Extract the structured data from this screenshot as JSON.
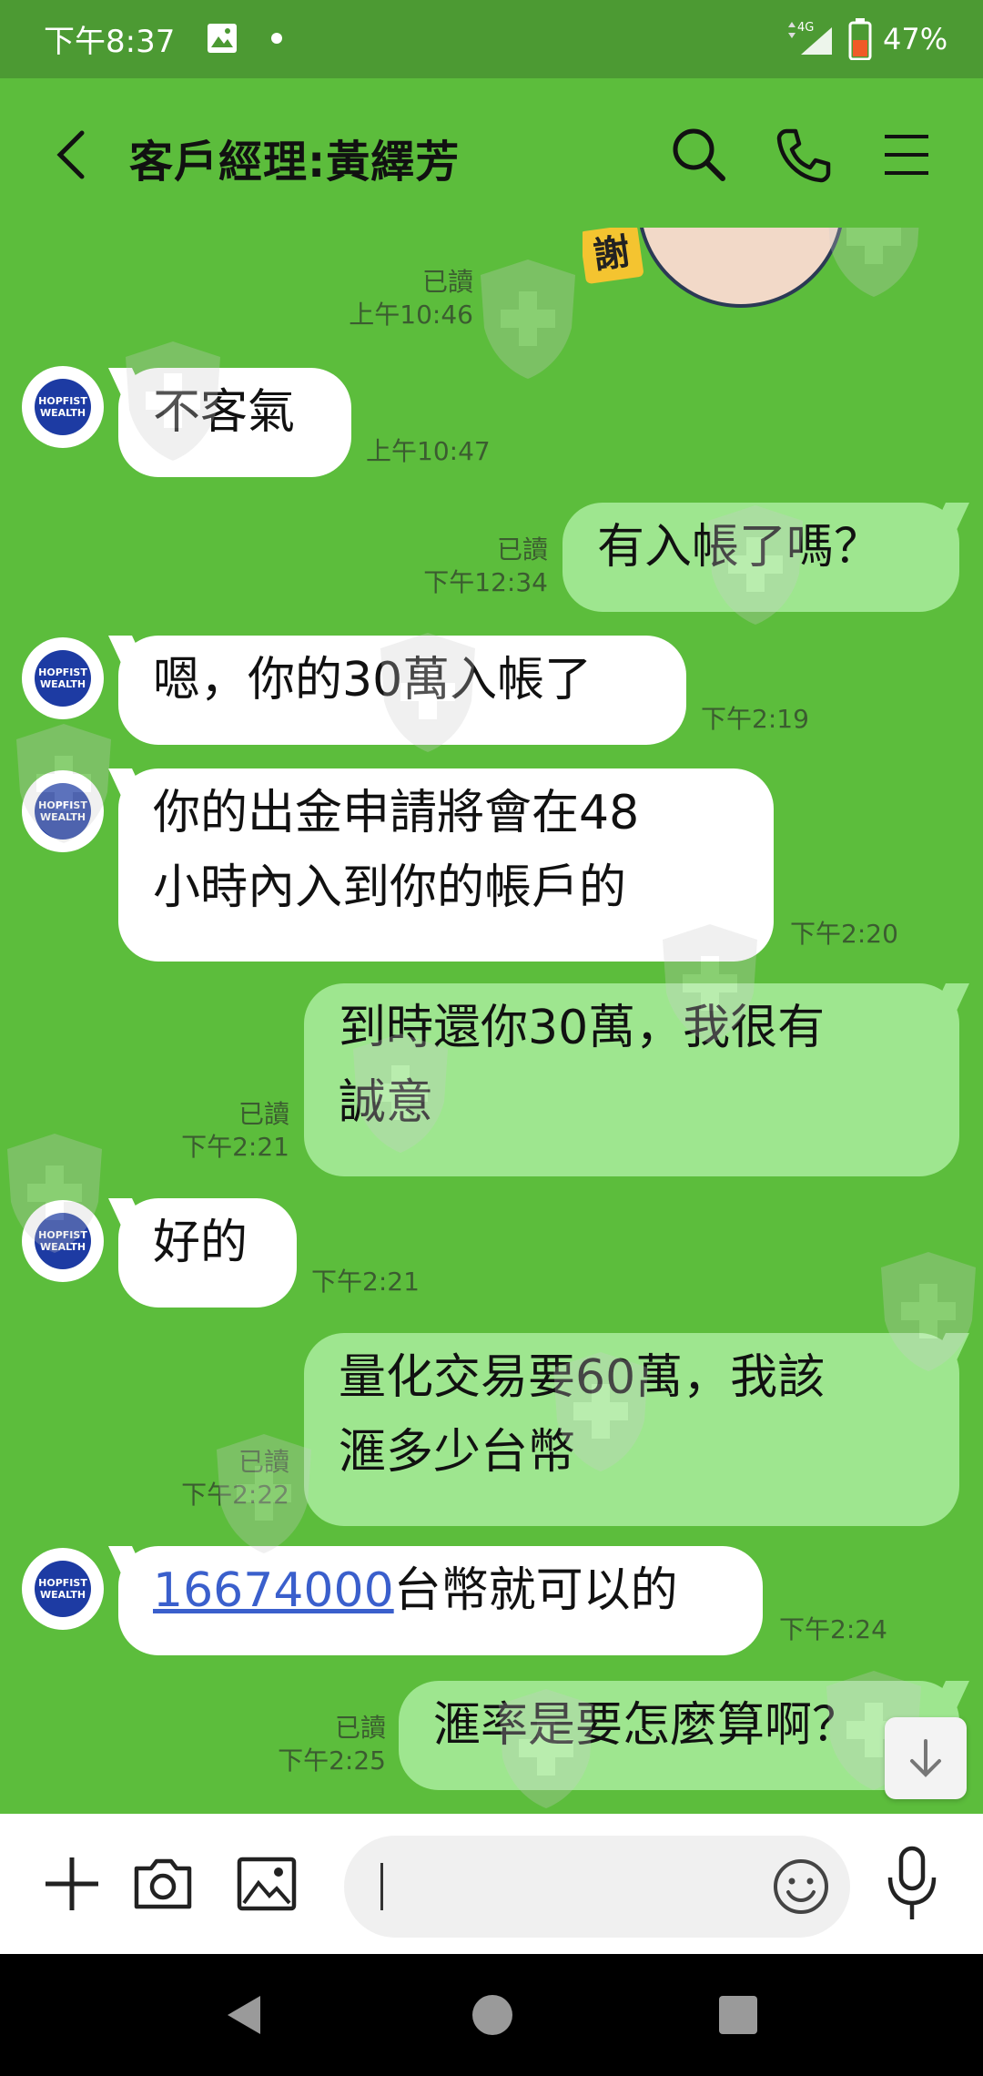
{
  "status_bar": {
    "time": "下午8:37",
    "network": "4G",
    "battery": "47%"
  },
  "header": {
    "title": "客戶經理:黃繹芳"
  },
  "messages": {
    "m1": {
      "read": "已讀",
      "time": "上午10:46"
    },
    "m2": {
      "text": "不客氣",
      "time": "上午10:47"
    },
    "m3": {
      "text": "有入帳了嗎？",
      "read": "已讀",
      "time": "下午12:34"
    },
    "m4": {
      "text": "嗯，你的30萬入帳了",
      "time": "下午2:19"
    },
    "m5": {
      "line1": "你的出金申請將會在48",
      "line2": "小時內入到你的帳戶的",
      "time": "下午2:20"
    },
    "m6": {
      "line1": "到時還你30萬，我很有",
      "line2": "誠意",
      "read": "已讀",
      "time": "下午2:21"
    },
    "m7": {
      "text": "好的",
      "time": "下午2:21"
    },
    "m8": {
      "line1": "量化交易要60萬，我該",
      "line2": "滙多少台幣",
      "read": "已讀",
      "time": "下午2:22"
    },
    "m9": {
      "link": "16674000",
      "text": "台幣就可以的",
      "time": "下午2:24"
    },
    "m10": {
      "text": "滙率是要怎麼算啊？",
      "read": "已讀",
      "time": "下午2:25"
    }
  },
  "sticker": {
    "tag": "謝"
  },
  "avatar": {
    "line1": "HOPFIST",
    "line2": "WEALTH"
  },
  "colors": {
    "chat_bg": "#5cbd3c",
    "out_bubble": "#9ee68f",
    "in_bubble": "#ffffff",
    "link": "#3a5fcc"
  },
  "icons": [
    "back-icon",
    "search-icon",
    "phone-icon",
    "menu-icon",
    "plus-icon",
    "camera-icon",
    "image-icon",
    "emoji-icon",
    "mic-icon",
    "arrow-down-icon"
  ]
}
